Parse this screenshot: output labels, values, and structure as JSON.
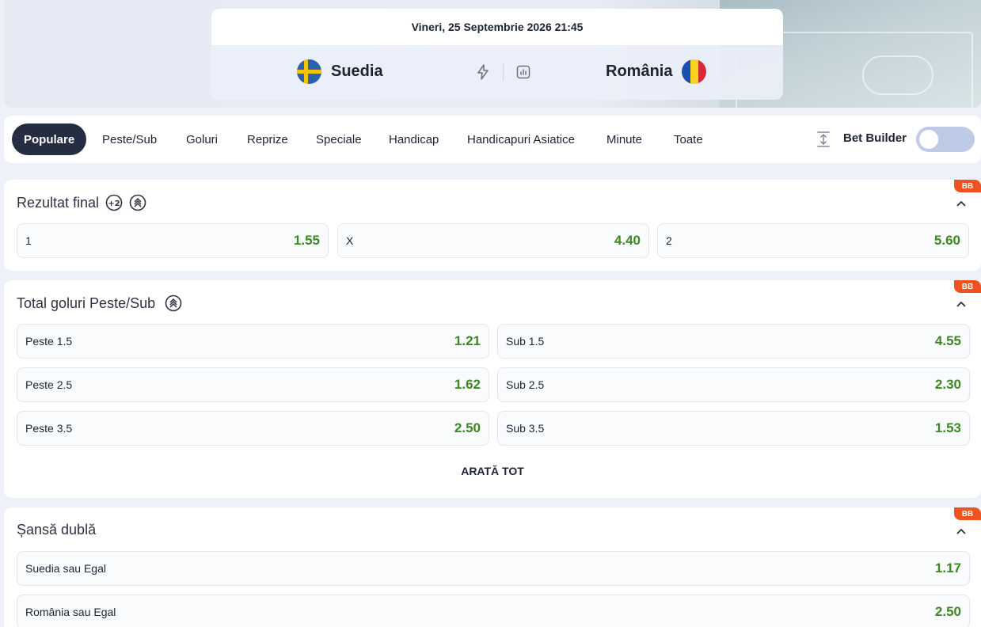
{
  "match": {
    "date": "Vineri, 25 Septembrie 2026 21:45",
    "home_team": "Suedia",
    "away_team": "România"
  },
  "tabs": [
    "Populare",
    "Peste/Sub",
    "Goluri",
    "Reprize",
    "Speciale",
    "Handicap",
    "Handicapuri Asiatice",
    "Minute",
    "Toate"
  ],
  "bet_builder": {
    "label": "Bet Builder",
    "enabled": false
  },
  "badge": "BB",
  "markets": {
    "result": {
      "title": "Rezultat final",
      "icon_text": "+2",
      "outcomes": [
        {
          "label": "1",
          "odd": "1.55"
        },
        {
          "label": "X",
          "odd": "4.40"
        },
        {
          "label": "2",
          "odd": "5.60"
        }
      ]
    },
    "totals": {
      "title": "Total goluri Peste/Sub",
      "rows": [
        {
          "over_label": "Peste 1.5",
          "over_odd": "1.21",
          "under_label": "Sub 1.5",
          "under_odd": "4.55"
        },
        {
          "over_label": "Peste 2.5",
          "over_odd": "1.62",
          "under_label": "Sub 2.5",
          "under_odd": "2.30"
        },
        {
          "over_label": "Peste 3.5",
          "over_odd": "2.50",
          "under_label": "Sub 3.5",
          "under_odd": "1.53"
        }
      ],
      "show_all": "ARATĂ TOT"
    },
    "double_chance": {
      "title": "Șansă dublă",
      "outcomes": [
        {
          "label": "Suedia sau Egal",
          "odd": "1.17"
        },
        {
          "label": "România sau Egal",
          "odd": "2.50"
        }
      ]
    }
  },
  "colors": {
    "odd": "#3a8a1e",
    "active_tab": "#252d43",
    "badge": "#f0521f"
  }
}
